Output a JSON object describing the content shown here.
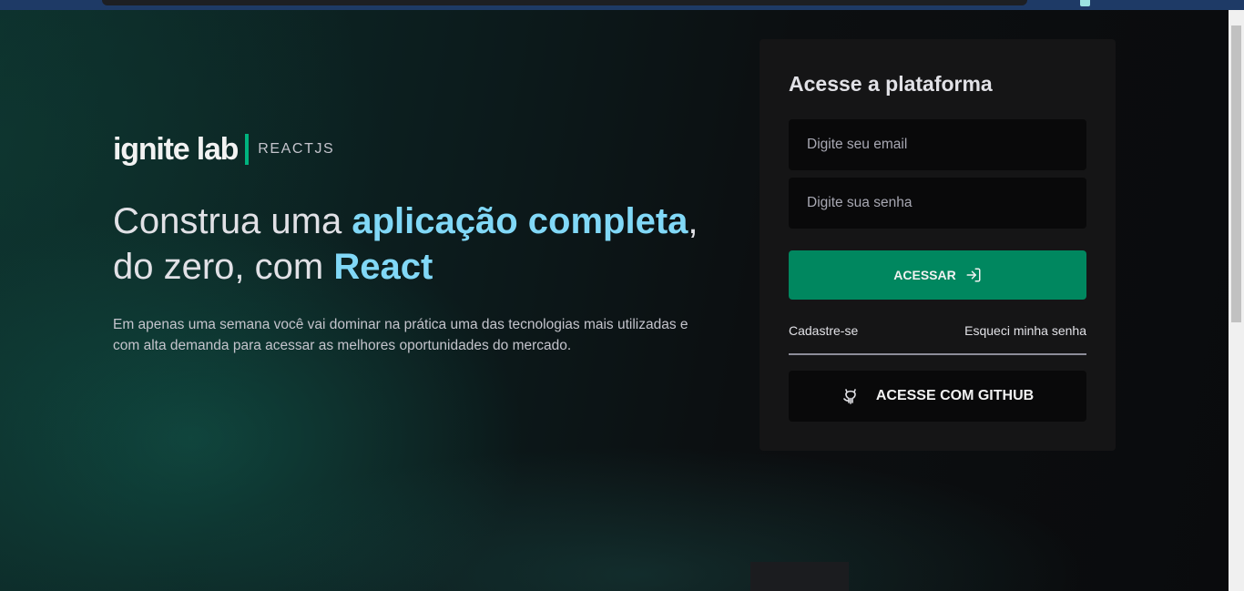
{
  "brand": {
    "logo": "ignite lab",
    "tag": "REACTJS"
  },
  "hero": {
    "line1_pre": "Construa uma ",
    "line1_highlight": "aplicação completa",
    "line1_post": ",",
    "line2_pre": "do zero, com ",
    "line2_highlight": "React",
    "description": "Em apenas uma semana você vai dominar na prática uma das tecnologias mais utilizadas e com alta demanda para acessar as melhores oportunidades do mercado."
  },
  "login": {
    "title": "Acesse a plataforma",
    "email_placeholder": "Digite seu email",
    "email_value": "",
    "password_placeholder": "Digite sua senha",
    "password_value": "",
    "submit_label": "ACESSAR",
    "signup_label": "Cadastre-se",
    "forgot_label": "Esqueci minha senha",
    "github_label": "ACESSE COM GITHUB"
  },
  "icons": {
    "submit": "sign-in-icon",
    "github": "github-icon"
  },
  "colors": {
    "accent_green": "#00875f",
    "brand_green": "#00b37e",
    "highlight_blue": "#81d8f7",
    "panel_bg": "#151516",
    "input_bg": "#09090a"
  }
}
